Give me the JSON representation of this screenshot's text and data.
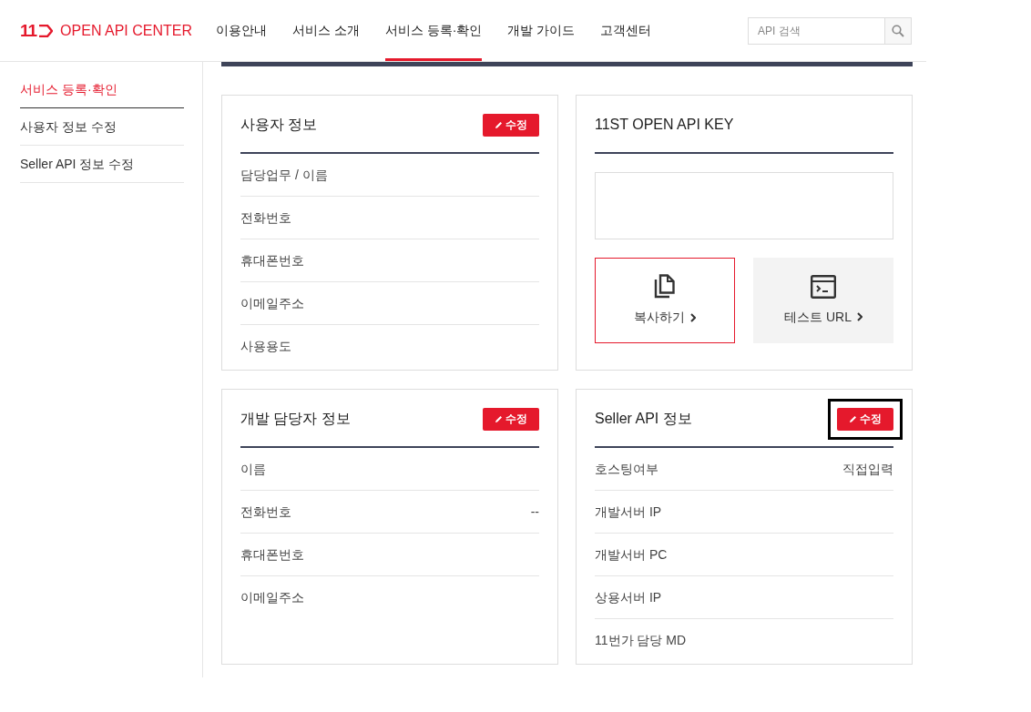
{
  "header": {
    "logo_mark": "11",
    "logo_text": "OPEN API CENTER",
    "nav": [
      {
        "label": "이용안내",
        "selected": false
      },
      {
        "label": "서비스 소개",
        "selected": false
      },
      {
        "label": "서비스 등록·확인",
        "selected": true
      },
      {
        "label": "개발 가이드",
        "selected": false
      },
      {
        "label": "고객센터",
        "selected": false
      }
    ],
    "search": {
      "placeholder": "API 검색"
    }
  },
  "sidebar": {
    "items": [
      {
        "label": "서비스 등록·확인",
        "selected": true
      },
      {
        "label": "사용자 정보 수정",
        "selected": false
      },
      {
        "label": "Seller API 정보 수정",
        "selected": false
      }
    ]
  },
  "cards": [
    {
      "kind": "info",
      "title": "사용자 정보",
      "edit_button": {
        "label": "수정",
        "highlighted": false
      },
      "rows": [
        {
          "label": "담당업무 / 이름"
        },
        {
          "label": "전화번호"
        },
        {
          "label": "휴대폰번호"
        },
        {
          "label": "이메일주소"
        },
        {
          "label": "사용용도"
        }
      ]
    },
    {
      "kind": "key",
      "title": "11ST OPEN API KEY",
      "actions": [
        {
          "kind": "copy",
          "label": "복사하기",
          "selected": true
        },
        {
          "kind": "test",
          "label": "테스트 URL",
          "selected": false
        }
      ]
    },
    {
      "kind": "info",
      "title": "개발 담당자 정보",
      "edit_button": {
        "label": "수정",
        "highlighted": false
      },
      "rows": [
        {
          "label": "이름"
        },
        {
          "label": "전화번호",
          "value": "--"
        },
        {
          "label": "휴대폰번호"
        },
        {
          "label": "이메일주소"
        }
      ]
    },
    {
      "kind": "info",
      "title": "Seller API 정보",
      "edit_button": {
        "label": "수정",
        "highlighted": true
      },
      "rows": [
        {
          "label": "호스팅여부",
          "value": "직접입력"
        },
        {
          "label": "개발서버 IP"
        },
        {
          "label": "개발서버 PC"
        },
        {
          "label": "상용서버 IP"
        },
        {
          "label": "11번가 담당 MD"
        }
      ]
    }
  ]
}
